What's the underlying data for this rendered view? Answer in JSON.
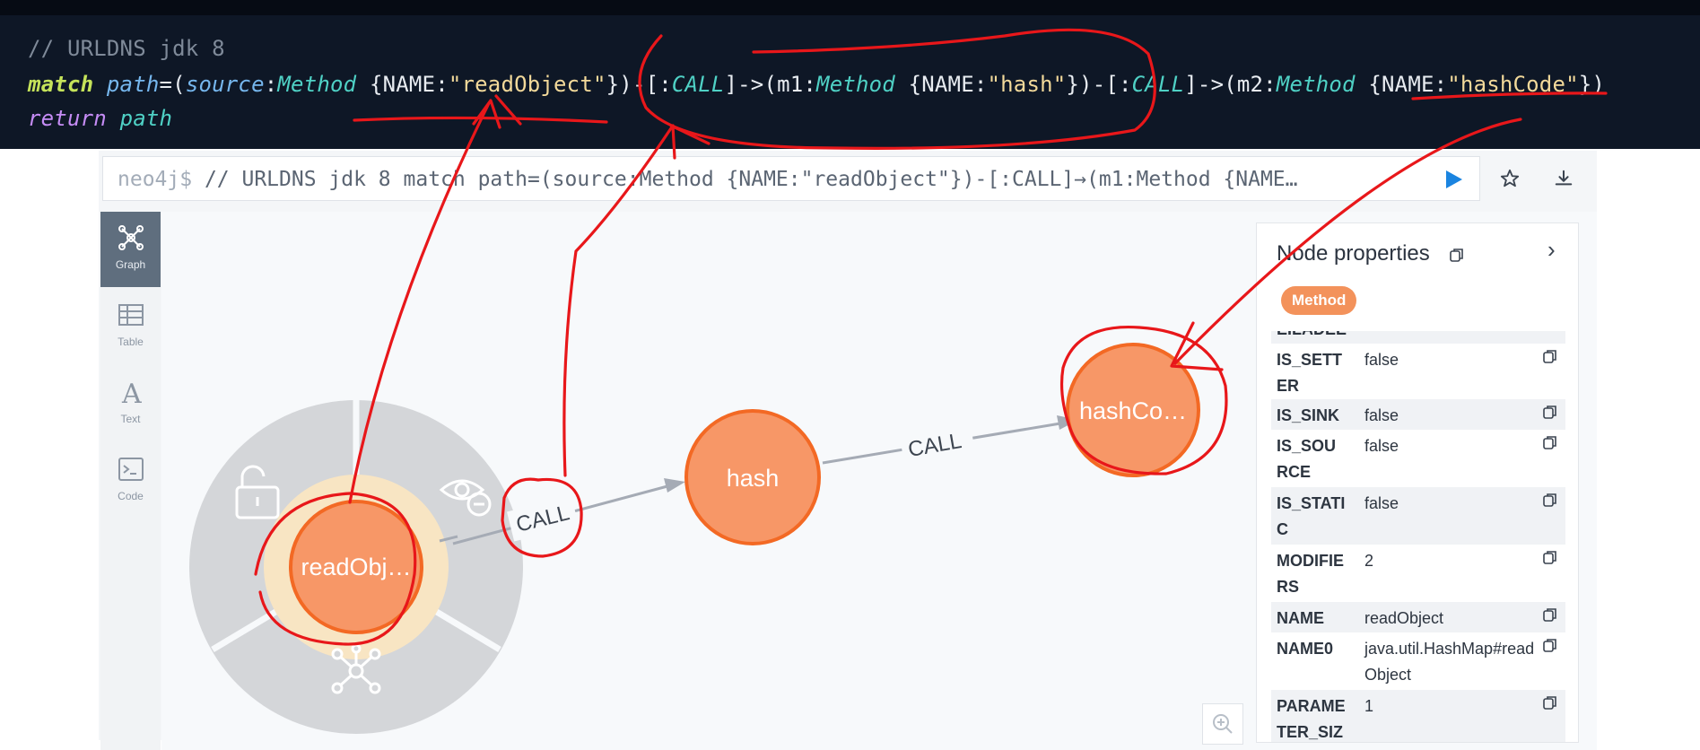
{
  "code": {
    "comment": "// URLDNS jdk 8",
    "line2": {
      "kw_match": "match",
      "var_path": "path",
      "eq_paren": "=(",
      "var_source": "source",
      "colon": ":",
      "label_method_1": "Method",
      "prop_open_1": " {NAME:",
      "str_readobject": "\"readObject\"",
      "close_1": "})-[:",
      "rel_call_1": "CALL",
      "arrow_1": "]->(m1:",
      "label_method_2": "Method",
      "prop_open_2": " {NAME:",
      "str_hash": "\"hash\"",
      "close_2": "})-[:",
      "rel_call_2": "CALL",
      "arrow_2": "]->(m2:",
      "label_method_3": "Method",
      "prop_open_3": " {NAME:",
      "str_hashcode": "\"hashCode\"",
      "close_3": "})"
    },
    "line3": {
      "kw_return": "return",
      "var_path": "path"
    }
  },
  "query_bar": {
    "prompt": "neo4j$",
    "text": " // URLDNS jdk 8 match path=(source:Method {NAME:\"readObject\"})-[:CALL]→(m1:Method {NAME…"
  },
  "side_nav": {
    "graph": "Graph",
    "table": "Table",
    "text": "Text",
    "code": "Code"
  },
  "graph": {
    "nodes": [
      {
        "id": "n1",
        "label": "readObj…",
        "selected": true
      },
      {
        "id": "n2",
        "label": "hash",
        "selected": false
      },
      {
        "id": "n3",
        "label": "hashCo…",
        "selected": false
      }
    ],
    "relationships": [
      {
        "from": "n1",
        "to": "n2",
        "type": "CALL"
      },
      {
        "from": "n2",
        "to": "n3",
        "type": "CALL"
      }
    ],
    "node_color": "#f79767",
    "node_border": "#f36924"
  },
  "panel": {
    "title": "Node properties",
    "badge": "Method",
    "partial_row": "EILADEE",
    "properties": [
      {
        "key": "IS_SETTER",
        "value": "false"
      },
      {
        "key": "IS_SINK",
        "value": "false"
      },
      {
        "key": "IS_SOURCE",
        "value": "false"
      },
      {
        "key": "IS_STATIC",
        "value": "false"
      },
      {
        "key": "MODIFIERS",
        "value": "2"
      },
      {
        "key": "NAME",
        "value": "readObject"
      },
      {
        "key": "NAME0",
        "value": "java.util.HashMap#readObject"
      },
      {
        "key": "PARAMETER_SIZE",
        "value": "1"
      }
    ]
  },
  "colors": {
    "code_bg": "#0e1726",
    "annotation_red": "#e8171a",
    "accent_blue": "#1a84e0"
  }
}
